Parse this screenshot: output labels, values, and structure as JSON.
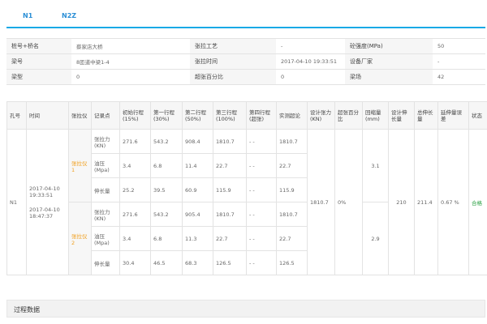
{
  "tabs": [
    "N1",
    "N2Z"
  ],
  "info": {
    "row1": {
      "l1": "桩号+桥名",
      "v1": "蔡家店大桥",
      "l2": "张拉工艺",
      "v2": "-",
      "l3": "砼强度(MPa)",
      "v3": "50"
    },
    "row2": {
      "l1": "梁号",
      "v1": "8匝道中梁1-4",
      "l2": "张拉时间",
      "v2": "2017-04-10 19:33:51",
      "l3": "设备厂家",
      "v3": "-"
    },
    "row3": {
      "l1": "梁型",
      "v1": "0",
      "l2": "超张百分比",
      "v2": "0",
      "l3": "梁场",
      "v3": "42"
    }
  },
  "table": {
    "headers": [
      "孔号",
      "时间",
      "张拉仪",
      "记录点",
      "初始行程(15%)",
      "第一行程(30%)",
      "第二行程(50%)",
      "第三行程(100%)",
      "第四行程(超张)",
      "实测超论",
      "设计张力(KN)",
      "超张百分比",
      "回缩量(mm)",
      "设计伸长量",
      "总伸长量",
      "延伸量误差",
      "状态"
    ],
    "hole": "N1",
    "time1": "2017-04-10 19:33:51",
    "time2": "2017-04-10 18:47:37",
    "device1": "张拉仪1",
    "device2": "张拉仪2",
    "group1": [
      {
        "label": "张拉力(KN)",
        "v": [
          "271.6",
          "543.2",
          "908.4",
          "1810.7",
          "- -",
          "1810.7"
        ]
      },
      {
        "label": "油压(Mpa)",
        "v": [
          "3.4",
          "6.8",
          "11.4",
          "22.7",
          "- -",
          "22.7"
        ]
      },
      {
        "label": "伸长量",
        "v": [
          "25.2",
          "39.5",
          "60.9",
          "115.9",
          "- -",
          "115.9"
        ]
      }
    ],
    "group2": [
      {
        "label": "张拉力(KN)",
        "v": [
          "271.6",
          "543.2",
          "905.4",
          "1810.7",
          "- -",
          "1810.7"
        ]
      },
      {
        "label": "油压(Mpa)",
        "v": [
          "3.4",
          "6.8",
          "11.3",
          "22.7",
          "- -",
          "22.7"
        ]
      },
      {
        "label": "伸长量",
        "v": [
          "30.4",
          "46.5",
          "68.3",
          "126.5",
          "- -",
          "126.5"
        ]
      }
    ],
    "design_force": "1810.7",
    "over_pct": "0%",
    "retract1": "3.1",
    "retract2": "2.9",
    "design_elong": "210",
    "total_elong": "211.4",
    "error": "0.67 %",
    "status": "合格"
  },
  "section_title": "过程数据",
  "colors": {
    "accent": "#19a9e6",
    "tab_text": "#2b8fd6",
    "device": "#f0a020",
    "status_ok": "#2aa043"
  }
}
